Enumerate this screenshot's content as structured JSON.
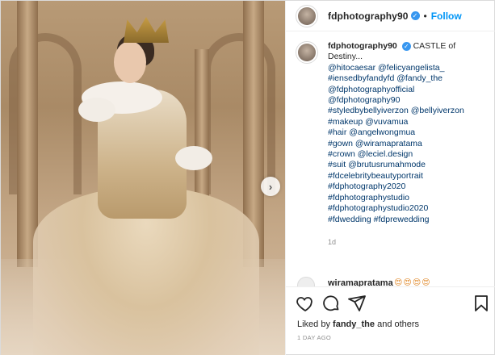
{
  "post": {
    "username": "fdphotography90",
    "verified_badge": "✓",
    "follow_label": "Follow",
    "separator": "•",
    "caption_title": "CASTLE of Destiny...",
    "caption_lines": [
      "@hitocaesar @felicyangelista_",
      "#iensedbyfandyfd @fandy_the",
      "@fdphotographyofficial",
      "@fdphotography90",
      "#styledbybellyiverzon @bellyiverzon",
      "#makeup @vuvamua",
      "#hair @angelwongmua",
      "#gown @wiramapratama",
      "#crown @leciel.design",
      "#suit @brutusrumahmode",
      "#fdcelebritybeautyportrait",
      "#fdphotography2020",
      "#fdphotographystudio",
      "#fdphotographystudio2020",
      "#fdwedding #fdprewedding"
    ],
    "caption_age": "1d",
    "next_comment_user": "wiramapratama",
    "next_comment_emojis": "😍😍😍😍",
    "liked_by_prefix": "Liked by",
    "liked_by_user": "fandy_the",
    "liked_by_suffix": "and others",
    "posted_ago": "1 DAY AGO"
  },
  "icons": {
    "like": "heart-icon",
    "comment": "comment-icon",
    "share": "paper-plane-icon",
    "save": "bookmark-icon",
    "next": "chevron-right-icon"
  },
  "colors": {
    "link": "#00376b",
    "follow": "#0095f6",
    "verified": "#3897f0",
    "muted": "#8e8e8e"
  }
}
